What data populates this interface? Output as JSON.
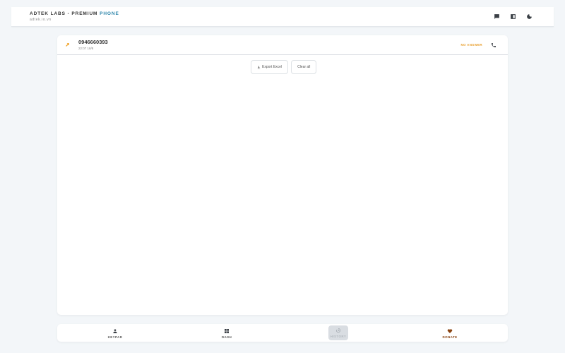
{
  "header": {
    "brand_main": "ADTEK LABS - PREMIUM ",
    "brand_accent": "PHONE",
    "subtitle": "adtek.io.vn",
    "icons": [
      "chat-icon",
      "layout-icon",
      "moon-icon"
    ]
  },
  "call_log": [
    {
      "number": "0946660393",
      "time": "22:07 18/8",
      "status": "NO ANSWER",
      "direction_icon": "outgoing-call-icon",
      "action_icon": "phone-icon"
    }
  ],
  "actions": {
    "export_label": "Export Excel",
    "clear_label": "Clear all"
  },
  "nav": {
    "items": [
      {
        "label": "KEYPAD",
        "icon": "person-icon"
      },
      {
        "label": "DASH",
        "icon": "grid-icon"
      },
      {
        "label": "HISTORY",
        "icon": "history-icon",
        "active": true
      },
      {
        "label": "DONATE",
        "icon": "heart-icon"
      }
    ]
  },
  "colors": {
    "accent": "#2e86ab",
    "status_warning": "#e8a030",
    "outgoing_arrow": "#f0a020",
    "donate": "#8b4513",
    "background": "#f3f6f9"
  }
}
